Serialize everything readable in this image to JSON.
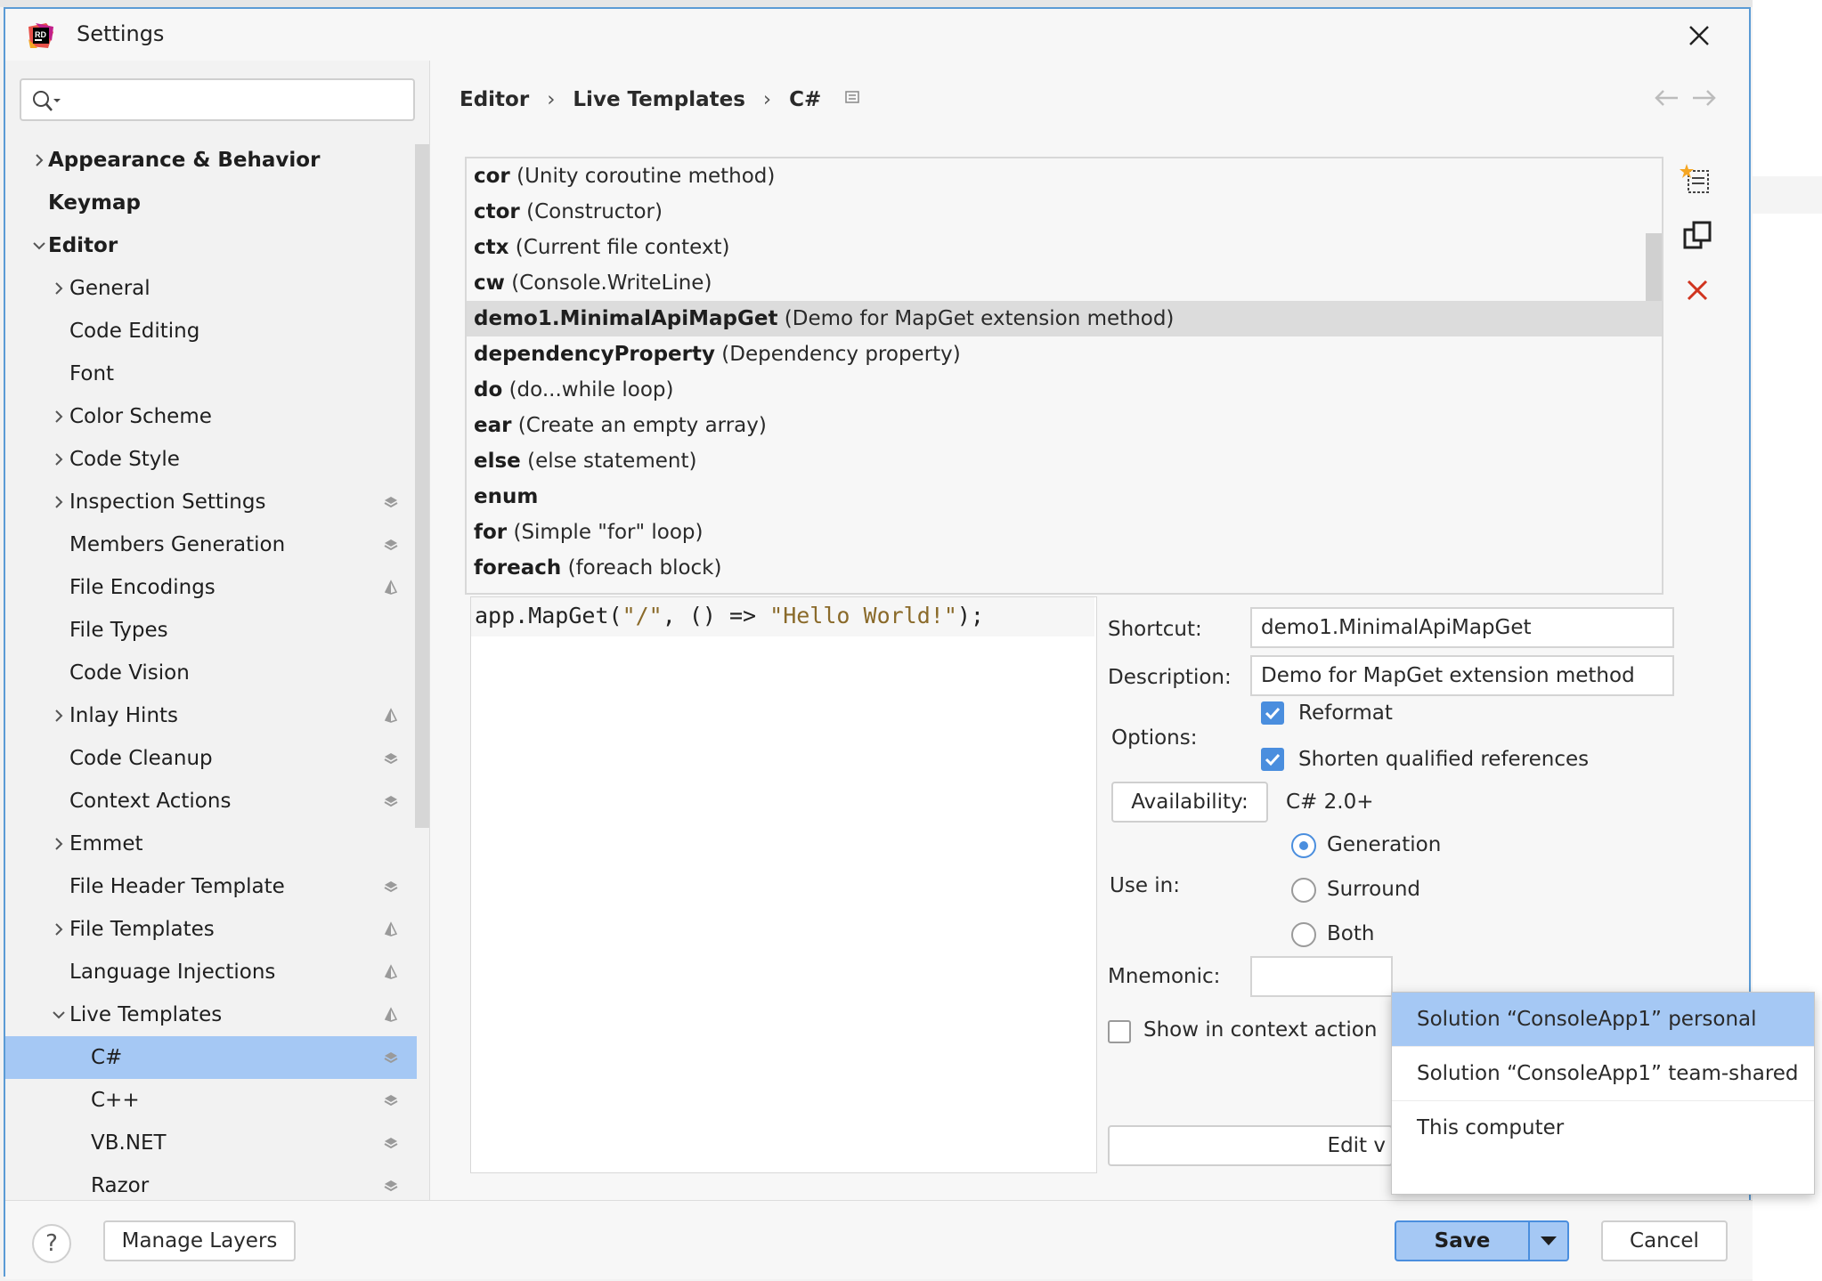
{
  "window": {
    "title": "Settings"
  },
  "search": {
    "placeholder": ""
  },
  "sidebar": {
    "items": [
      {
        "label": "Appearance & Behavior",
        "level": 0,
        "expandable": true,
        "expanded": false,
        "bold": true
      },
      {
        "label": "Keymap",
        "level": 0,
        "expandable": false,
        "bold": true
      },
      {
        "label": "Editor",
        "level": 0,
        "expandable": true,
        "expanded": true,
        "bold": true
      },
      {
        "label": "General",
        "level": 1,
        "expandable": true
      },
      {
        "label": "Code Editing",
        "level": 1
      },
      {
        "label": "Font",
        "level": 1
      },
      {
        "label": "Color Scheme",
        "level": 1,
        "expandable": true
      },
      {
        "label": "Code Style",
        "level": 1,
        "expandable": true
      },
      {
        "label": "Inspection Settings",
        "level": 1,
        "expandable": true,
        "layer_icon": "layers-icon"
      },
      {
        "label": "Members Generation",
        "level": 1,
        "layer_icon": "layers-icon"
      },
      {
        "label": "File Encodings",
        "level": 1,
        "layer_icon": "project-icon"
      },
      {
        "label": "File Types",
        "level": 1
      },
      {
        "label": "Code Vision",
        "level": 1
      },
      {
        "label": "Inlay Hints",
        "level": 1,
        "expandable": true,
        "layer_icon": "project-icon"
      },
      {
        "label": "Code Cleanup",
        "level": 1,
        "layer_icon": "layers-icon"
      },
      {
        "label": "Context Actions",
        "level": 1,
        "layer_icon": "layers-icon"
      },
      {
        "label": "Emmet",
        "level": 1,
        "expandable": true
      },
      {
        "label": "File Header Template",
        "level": 1,
        "layer_icon": "layers-icon"
      },
      {
        "label": "File Templates",
        "level": 1,
        "expandable": true,
        "layer_icon": "project-icon"
      },
      {
        "label": "Language Injections",
        "level": 1,
        "layer_icon": "project-icon"
      },
      {
        "label": "Live Templates",
        "level": 1,
        "expandable": true,
        "expanded": true,
        "layer_icon": "project-icon"
      },
      {
        "label": "C#",
        "level": 2,
        "selected": true,
        "layer_icon": "layers-icon"
      },
      {
        "label": "C++",
        "level": 2,
        "layer_icon": "layers-icon"
      },
      {
        "label": "VB.NET",
        "level": 2,
        "layer_icon": "layers-icon"
      },
      {
        "label": "Razor",
        "level": 2,
        "layer_icon": "layers-icon"
      }
    ]
  },
  "breadcrumb": {
    "items": [
      "Editor",
      "Live Templates",
      "C#"
    ]
  },
  "templates": [
    {
      "name": "cor",
      "desc": "(Unity coroutine method)"
    },
    {
      "name": "ctor",
      "desc": "(Constructor)"
    },
    {
      "name": "ctx",
      "desc": "(Current file context)"
    },
    {
      "name": "cw",
      "desc": "(Console.WriteLine)"
    },
    {
      "name": "demo1.MinimalApiMapGet",
      "desc": "(Demo for MapGet extension method)",
      "selected": true
    },
    {
      "name": "dependencyProperty",
      "desc": "(Dependency property)"
    },
    {
      "name": "do",
      "desc": "(do...while loop)"
    },
    {
      "name": "ear",
      "desc": "(Create an empty array)"
    },
    {
      "name": "else",
      "desc": "(else statement)"
    },
    {
      "name": "enum",
      "desc": ""
    },
    {
      "name": "for",
      "desc": "(Simple \"for\" loop)"
    },
    {
      "name": "foreach",
      "desc": "(foreach block)"
    }
  ],
  "code": {
    "part1": "app.MapGet(",
    "str1": "\"/\"",
    "part2": ", () => ",
    "str2": "\"Hello World!\"",
    "part3": ");"
  },
  "props": {
    "shortcut_label": "Shortcut:",
    "shortcut_value": "demo1.MinimalApiMapGet",
    "description_label": "Description:",
    "description_value": "Demo for MapGet extension method",
    "options_label": "Options:",
    "reformat_label": "Reformat",
    "shorten_label": "Shorten qualified references",
    "availability_button": "Availability:",
    "availability_value": "C# 2.0+",
    "usein_label": "Use in:",
    "generation_label": "Generation",
    "surround_label": "Surround",
    "both_label": "Both",
    "mnemonic_label": "Mnemonic:",
    "show_context_label": "Show in context action",
    "edit_button": "Edit v"
  },
  "dropdown": {
    "items": [
      "Solution “ConsoleApp1” personal",
      "Solution “ConsoleApp1” team-shared",
      "This computer"
    ],
    "selected_index": 0
  },
  "footer": {
    "help": "?",
    "manage_layers": "Manage Layers",
    "save": "Save",
    "cancel": "Cancel"
  },
  "colors": {
    "accent": "#4a8ede",
    "selection": "#a5c8f4",
    "delete": "#d0341f"
  }
}
